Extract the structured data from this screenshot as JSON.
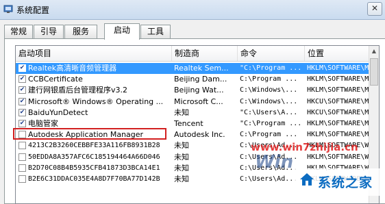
{
  "window": {
    "title": "系统配置",
    "close_label": "✕"
  },
  "tabs": [
    {
      "label": "常规",
      "active": false
    },
    {
      "label": "引导",
      "active": false
    },
    {
      "label": "服务",
      "active": false
    },
    {
      "label": "启动",
      "active": true
    },
    {
      "label": "工具",
      "active": false
    }
  ],
  "list": {
    "columns": [
      "启动项目",
      "制造商",
      "命令",
      "位置"
    ],
    "rows": [
      {
        "checked": true,
        "name": "Realtek高清晰音频管理器",
        "maker": "Realtek Sem...",
        "command": "\"C:\\Program ...",
        "location": "HKLM\\SOFTWARE\\M",
        "selected": true
      },
      {
        "checked": true,
        "name": "CCBCertificate",
        "maker": "Beijing Dam...",
        "command": "C:\\Program ...",
        "location": "HKLM\\SOFTWARE\\M",
        "selected": false
      },
      {
        "checked": true,
        "name": "建行网银盾后台管理程序v3.2",
        "maker": "Beijing Wat...",
        "command": "C:\\Windows\\...",
        "location": "HKLM\\SOFTWARE\\M",
        "selected": false
      },
      {
        "checked": true,
        "name": "Microsoft® Windows® Operating ...",
        "maker": "Microsoft C...",
        "command": "C:\\Windows\\...",
        "location": "HKCU\\SOFTWARE\\M",
        "selected": false
      },
      {
        "checked": true,
        "name": "BaiduYunDetect",
        "maker": "未知",
        "command": "\"C:\\Users\\A...",
        "location": "HKCU\\SOFTWARE\\M",
        "selected": false
      },
      {
        "checked": true,
        "name": "电脑管家",
        "maker": "Tencent",
        "command": "\"C:\\Program ...",
        "location": "HKLM\\SOFTWARE\\M",
        "selected": false
      },
      {
        "checked": false,
        "name": "Autodesk Application Manager",
        "maker": "Autodesk Inc.",
        "command": "C:\\Program ...",
        "location": "HKLM\\SOFTWARE\\M",
        "selected": false
      },
      {
        "checked": false,
        "name": "4213C2B3260CEBBFE33A116FB8931B28",
        "maker": "未知",
        "command": "C:\\Users\\Ad...",
        "location": "HKLM\\SOFTWARE\\W",
        "selected": false
      },
      {
        "checked": false,
        "name": "50EDDA8A357AFC6C185194464A66D046",
        "maker": "未知",
        "command": "C:\\Users\\Ad...",
        "location": "HKLM\\SOFTWARE\\W",
        "selected": false
      },
      {
        "checked": false,
        "name": "B2D70C08B4B5935CFB41873D3BCA14E1",
        "maker": "未知",
        "command": "C:\\Users\\Ad...",
        "location": "HKLM\\SOFTWARE\\W",
        "selected": false
      },
      {
        "checked": false,
        "name": "B2E6C31DDAC035E4A8D7F70BA77D142B",
        "maker": "未知",
        "command": "C:\\Users\\Ad...",
        "location": "HKLM\\SOFTWARE\\W",
        "selected": false
      }
    ]
  },
  "watermark": {
    "site": "www.win7zhijia.cn",
    "logo_letters": "Win",
    "brand": "系统之家"
  },
  "colors": {
    "selection": "#3399ff",
    "highlight_box": "#d21f1f",
    "brand": "#0c6cc1"
  }
}
